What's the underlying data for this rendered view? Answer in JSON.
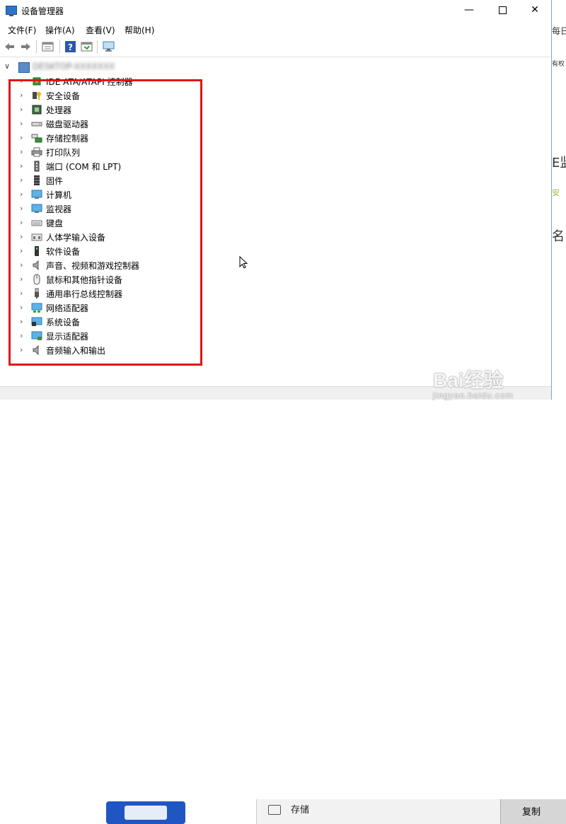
{
  "window": {
    "title": "设备管理器"
  },
  "menu": [
    {
      "label": "文件(F)"
    },
    {
      "label": "操作(A)"
    },
    {
      "label": "查看(V)"
    },
    {
      "label": "帮助(H)"
    }
  ],
  "toolbar": [
    "back-icon",
    "forward-icon",
    "properties-icon",
    "help-icon",
    "update-icon",
    "monitor-icon"
  ],
  "tree": {
    "root_label": "DESKTOP-XXXXXXX",
    "items": [
      {
        "label": "IDE ATA/ATAPI 控制器",
        "icon": "ide-controller-icon"
      },
      {
        "label": "安全设备",
        "icon": "security-key-icon"
      },
      {
        "label": "处理器",
        "icon": "processor-icon"
      },
      {
        "label": "磁盘驱动器",
        "icon": "disk-drive-icon"
      },
      {
        "label": "存储控制器",
        "icon": "storage-controller-icon"
      },
      {
        "label": "打印队列",
        "icon": "printer-icon"
      },
      {
        "label": "端口 (COM 和 LPT)",
        "icon": "port-icon"
      },
      {
        "label": "固件",
        "icon": "firmware-icon"
      },
      {
        "label": "计算机",
        "icon": "computer-icon"
      },
      {
        "label": "监视器",
        "icon": "monitor-icon"
      },
      {
        "label": "键盘",
        "icon": "keyboard-icon"
      },
      {
        "label": "人体学输入设备",
        "icon": "hid-icon"
      },
      {
        "label": "软件设备",
        "icon": "software-device-icon"
      },
      {
        "label": "声音、视频和游戏控制器",
        "icon": "speaker-icon"
      },
      {
        "label": "鼠标和其他指针设备",
        "icon": "mouse-icon"
      },
      {
        "label": "通用串行总线控制器",
        "icon": "usb-icon"
      },
      {
        "label": "网络适配器",
        "icon": "network-icon"
      },
      {
        "label": "系统设备",
        "icon": "system-device-icon"
      },
      {
        "label": "显示适配器",
        "icon": "display-adapter-icon"
      },
      {
        "label": "音频输入和输出",
        "icon": "audio-io-icon"
      }
    ]
  },
  "background": {
    "right_fragments": [
      "每日",
      "有权",
      "E监",
      "安",
      "名"
    ],
    "panel_label": "存储",
    "copy_label": "复制"
  },
  "watermark": {
    "main": "Bai经验",
    "sub": "jingyan.baidu.com"
  },
  "colors": {
    "highlight": "#e01515",
    "accent": "#2e73c9"
  }
}
